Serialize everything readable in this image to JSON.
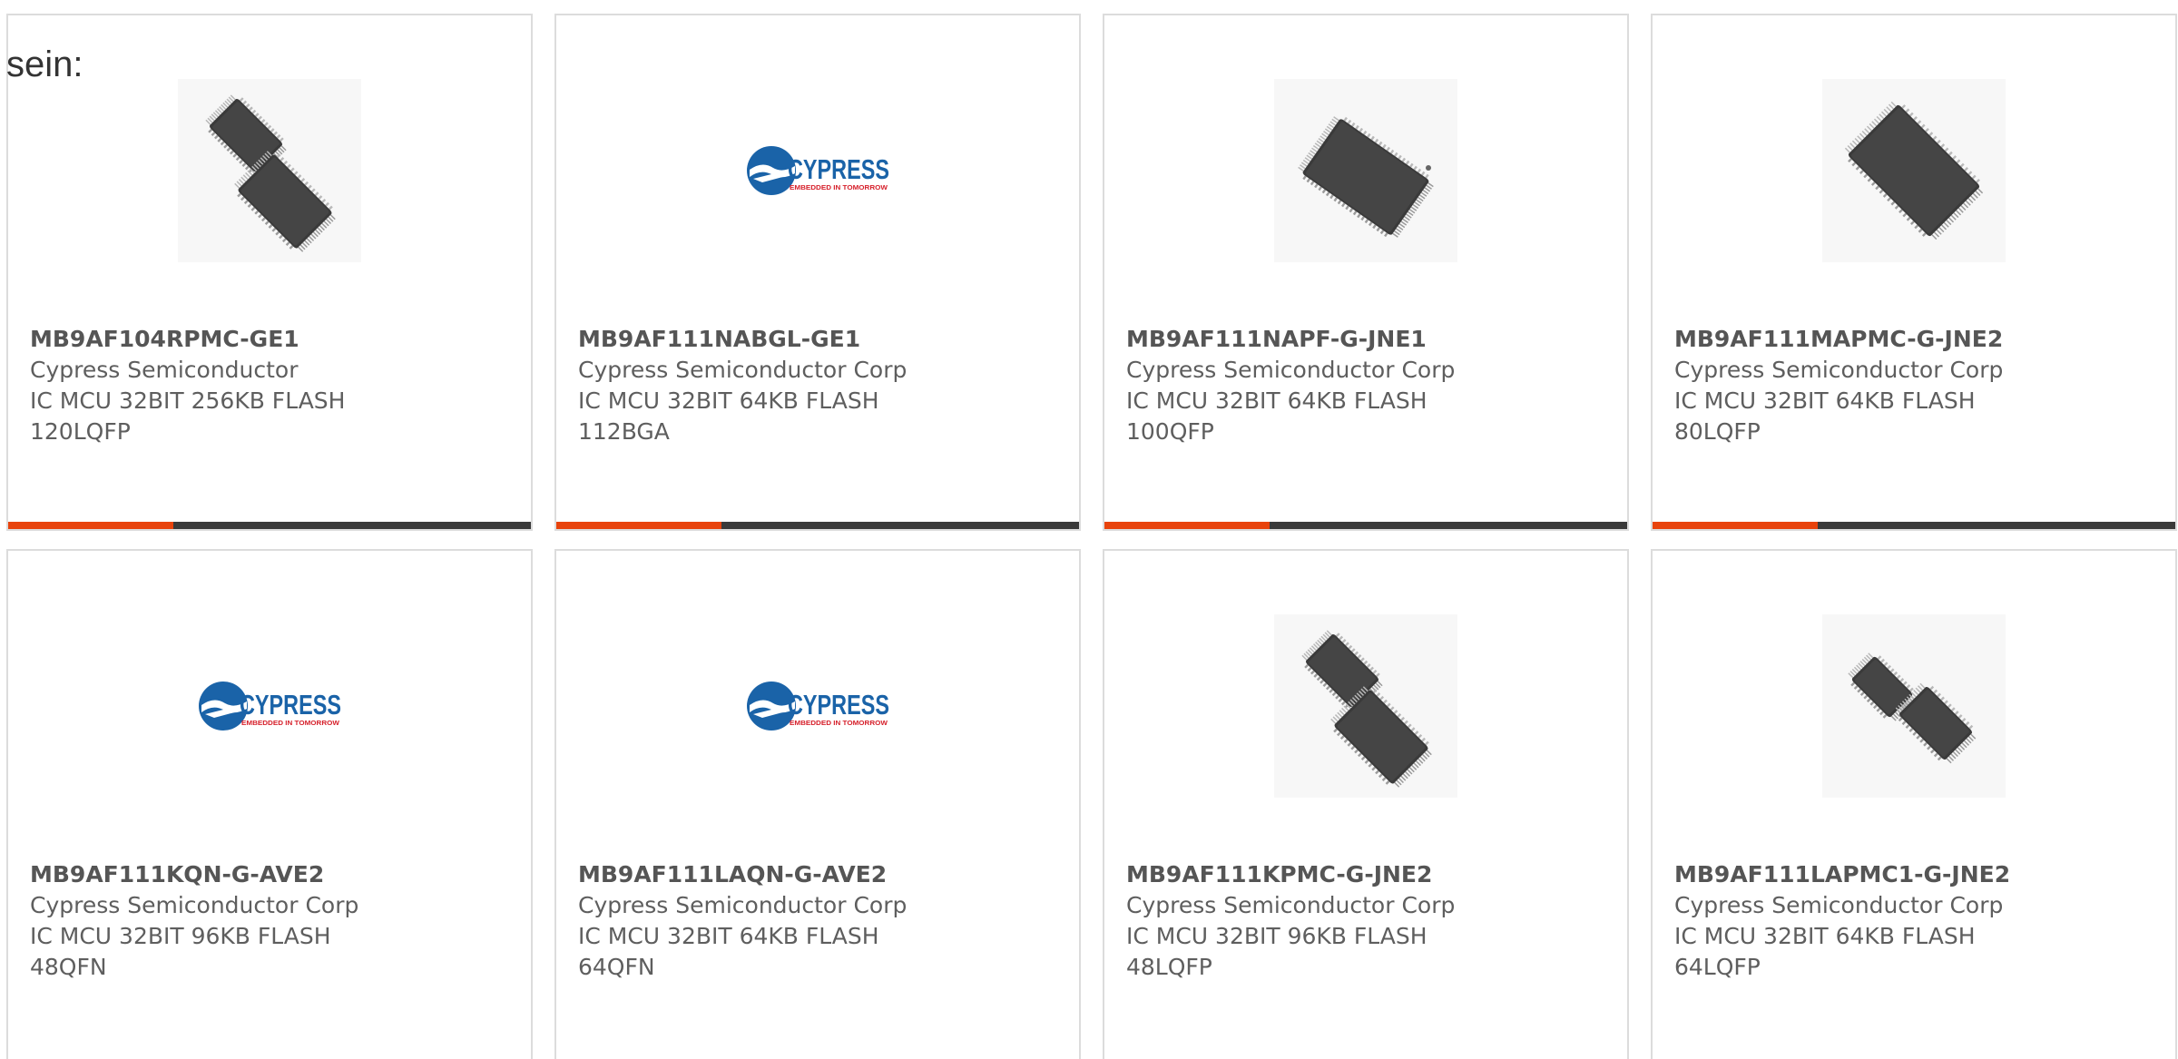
{
  "intro_text": "sein:",
  "colors": {
    "accent": "#e8430c",
    "bar_dark": "#3a3a3a",
    "card_border": "#dcdcdc",
    "cypress_blue": "#1a63a8",
    "cypress_red": "#d6202b"
  },
  "logo": {
    "brand": "CYPRESS",
    "tagline": "EMBEDDED IN TOMORROW"
  },
  "products": [
    {
      "part": "MB9AF104RPMC-GE1",
      "maker": "Cypress Semiconductor",
      "desc": "IC MCU 32BIT 256KB FLASH 120LQFP",
      "image": "two-qfp-chips"
    },
    {
      "part": "MB9AF111NABGL-GE1",
      "maker": "Cypress Semiconductor Corp",
      "desc": "IC MCU 32BIT 64KB FLASH 112BGA",
      "image": "cypress-logo"
    },
    {
      "part": "MB9AF111NAPF-G-JNE1",
      "maker": "Cypress Semiconductor Corp",
      "desc": "IC MCU 32BIT 64KB FLASH 100QFP",
      "image": "single-qfp-chip"
    },
    {
      "part": "MB9AF111MAPMC-G-JNE2",
      "maker": "Cypress Semiconductor Corp",
      "desc": "IC MCU 32BIT 64KB FLASH 80LQFP",
      "image": "single-lqfp-chip"
    },
    {
      "part": "MB9AF111KQN-G-AVE2",
      "maker": "Cypress Semiconductor Corp",
      "desc": "IC MCU 32BIT 96KB FLASH 48QFN",
      "image": "cypress-logo"
    },
    {
      "part": "MB9AF111LAQN-G-AVE2",
      "maker": "Cypress Semiconductor Corp",
      "desc": "IC MCU 32BIT 64KB FLASH 64QFN",
      "image": "cypress-logo"
    },
    {
      "part": "MB9AF111KPMC-G-JNE2",
      "maker": "Cypress Semiconductor Corp",
      "desc": "IC MCU 32BIT 96KB FLASH 48LQFP",
      "image": "two-qfp-chips"
    },
    {
      "part": "MB9AF111LAPMC1-G-JNE2",
      "maker": "Cypress Semiconductor Corp",
      "desc": "IC MCU 32BIT 64KB FLASH 64LQFP",
      "image": "two-qfp-chips-small"
    }
  ]
}
